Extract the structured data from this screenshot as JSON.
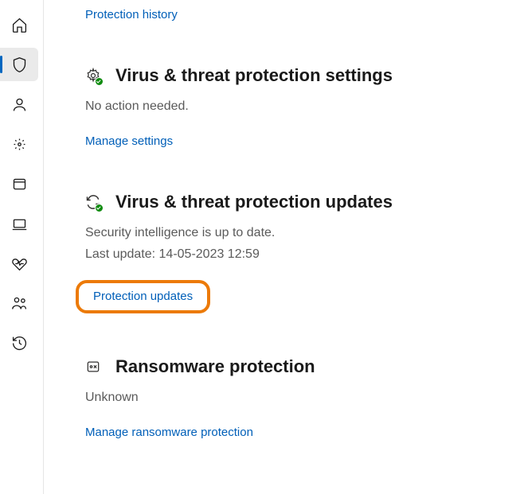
{
  "sidebar": {
    "items": [
      {
        "name": "home"
      },
      {
        "name": "virus-threat-protection",
        "selected": true
      },
      {
        "name": "account-protection"
      },
      {
        "name": "firewall-network"
      },
      {
        "name": "app-browser-control"
      },
      {
        "name": "device-security"
      },
      {
        "name": "device-performance"
      },
      {
        "name": "family-options"
      },
      {
        "name": "protection-history"
      }
    ]
  },
  "links": {
    "protection_history": "Protection history",
    "manage_settings": "Manage settings",
    "protection_updates": "Protection updates",
    "manage_ransomware": "Manage ransomware protection"
  },
  "sections": {
    "settings": {
      "title": "Virus & threat protection settings",
      "status": "No action needed."
    },
    "updates": {
      "title": "Virus & threat protection updates",
      "status": "Security intelligence is up to date.",
      "last_update": "Last update: 14-05-2023 12:59"
    },
    "ransomware": {
      "title": "Ransomware protection",
      "status": "Unknown"
    }
  }
}
